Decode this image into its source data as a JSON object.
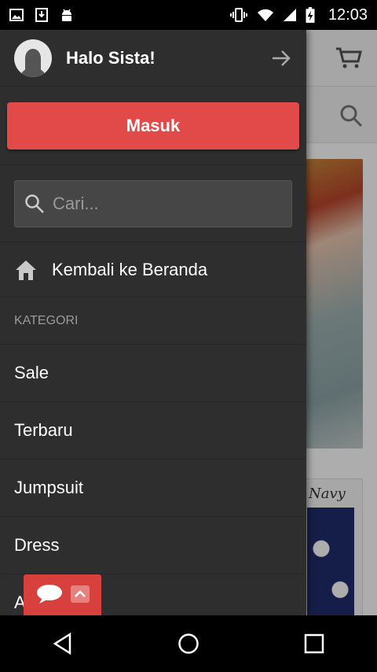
{
  "status_bar": {
    "time": "12:03",
    "left_icons": [
      "image-icon",
      "download-icon",
      "android-icon"
    ],
    "right_icons": [
      "vibrate-icon",
      "wifi-icon",
      "signal-icon",
      "battery-charging-icon"
    ]
  },
  "background_app": {
    "product_label": "Navy"
  },
  "drawer": {
    "greeting": "Halo Sista!",
    "login_label": "Masuk",
    "search_placeholder": "Cari...",
    "home_label": "Kembali ke Beranda",
    "category_header": "KATEGORI",
    "categories": [
      "Sale",
      "Terbaru",
      "Jumpsuit",
      "Dress",
      "Atasan"
    ]
  },
  "colors": {
    "accent": "#e24a4a",
    "drawer_bg": "#2e2e2e"
  }
}
